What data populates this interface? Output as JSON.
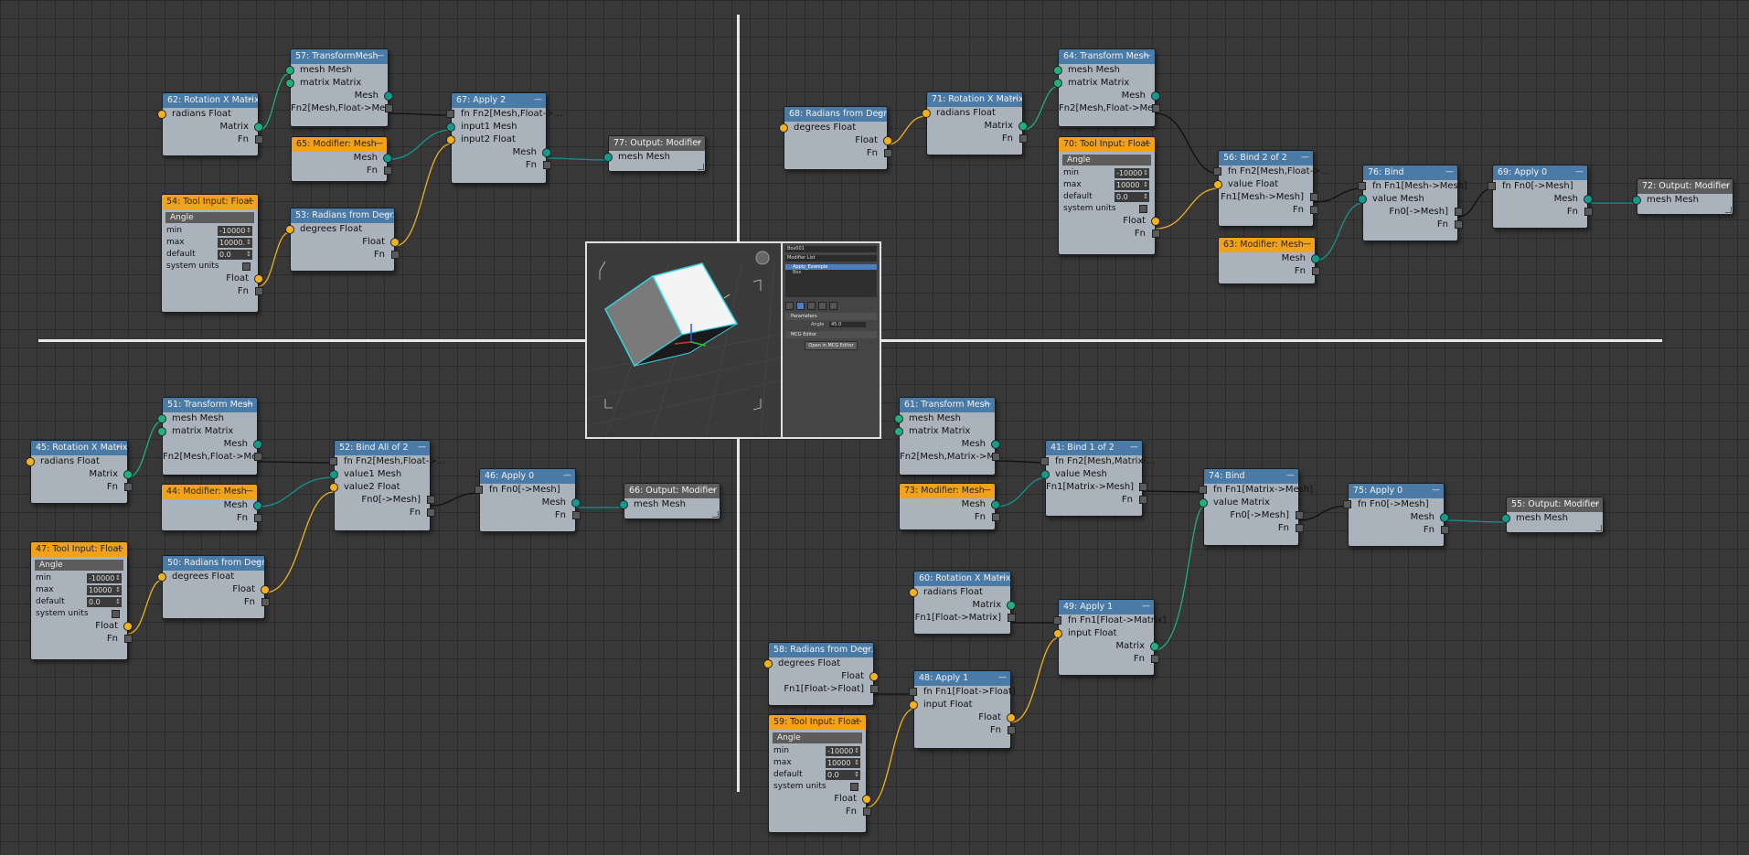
{
  "nodes": {
    "n57": {
      "title": "57: TransformMesh",
      "in": [
        "mesh Mesh",
        "matrix Matrix"
      ],
      "out": [
        "Mesh",
        "Fn2[Mesh,Float->Me..."
      ]
    },
    "n62": {
      "title": "62: Rotation X Matrix",
      "in": [
        "radians Float"
      ],
      "out": [
        "Matrix",
        "Fn"
      ]
    },
    "n65": {
      "title": "65: Modifier: Mesh",
      "out": [
        "Mesh",
        "Fn"
      ]
    },
    "n67": {
      "title": "67: Apply 2",
      "in": [
        "fn Fn2[Mesh,Float->...",
        "input1 Mesh",
        "input2 Float"
      ],
      "out": [
        "Mesh",
        "Fn"
      ]
    },
    "n77": {
      "title": "77: Output: Modifier",
      "in": [
        "mesh Mesh"
      ]
    },
    "n54": {
      "title": "54: Tool Input: Float",
      "label": "Angle",
      "min_label": "min",
      "min": "-10000",
      "max_label": "max",
      "max": "10000.",
      "default_label": "default",
      "default": "0.0",
      "sys_label": "system units",
      "out": [
        "Float",
        "Fn"
      ]
    },
    "n53": {
      "title": "53: Radians from Degr...",
      "in": [
        "degrees Float"
      ],
      "out": [
        "Float",
        "Fn"
      ]
    },
    "n64": {
      "title": "64: Transform Mesh",
      "in": [
        "mesh Mesh",
        "matrix Matrix"
      ],
      "out": [
        "Mesh",
        "Fn2[Mesh,Float->Me..."
      ]
    },
    "n68": {
      "title": "68: Radians from Degr...",
      "in": [
        "degrees Float"
      ],
      "out": [
        "Float",
        "Fn"
      ]
    },
    "n71": {
      "title": "71: Rotation X Matrix",
      "in": [
        "radians Float"
      ],
      "out": [
        "Matrix",
        "Fn"
      ]
    },
    "n70": {
      "title": "70: Tool Input: Float",
      "label": "Angle",
      "min_label": "min",
      "min": "-10000",
      "max_label": "max",
      "max": "10000",
      "default_label": "default",
      "default": "0.0",
      "sys_label": "system units",
      "out": [
        "Float",
        "Fn"
      ]
    },
    "n56": {
      "title": "56: Bind 2 of 2",
      "in": [
        "fn Fn2[Mesh,Float->...",
        "value Float"
      ],
      "out": [
        "Fn1[Mesh->Mesh]",
        "Fn"
      ]
    },
    "n76": {
      "title": "76: Bind",
      "in": [
        "fn Fn1[Mesh->Mesh]",
        "value Mesh"
      ],
      "out": [
        "Fn0[->Mesh]",
        "Fn"
      ]
    },
    "n69": {
      "title": "69: Apply 0",
      "in": [
        "fn Fn0[->Mesh]"
      ],
      "out": [
        "Mesh",
        "Fn"
      ]
    },
    "n72": {
      "title": "72: Output: Modifier",
      "in": [
        "mesh Mesh"
      ]
    },
    "n63": {
      "title": "63: Modifier: Mesh",
      "out": [
        "Mesh",
        "Fn"
      ]
    },
    "n51": {
      "title": "51: Transform Mesh",
      "in": [
        "mesh Mesh",
        "matrix Matrix"
      ],
      "out": [
        "Mesh",
        "Fn2[Mesh,Float->Me..."
      ]
    },
    "n45": {
      "title": "45: Rotation X Matrix",
      "in": [
        "radians Float"
      ],
      "out": [
        "Matrix",
        "Fn"
      ]
    },
    "n44": {
      "title": "44: Modifier: Mesh",
      "out": [
        "Mesh",
        "Fn"
      ]
    },
    "n52": {
      "title": "52: Bind All of 2",
      "in": [
        "fn Fn2[Mesh,Float->...",
        "value1 Mesh",
        "value2 Float"
      ],
      "out": [
        "Fn0[->Mesh]",
        "Fn"
      ]
    },
    "n46": {
      "title": "46: Apply 0",
      "in": [
        "fn Fn0[->Mesh]"
      ],
      "out": [
        "Mesh",
        "Fn"
      ]
    },
    "n66": {
      "title": "66: Output: Modifier",
      "in": [
        "mesh Mesh"
      ]
    },
    "n47": {
      "title": "47: Tool Input: Float",
      "label": "Angle",
      "min_label": "min",
      "min": "-10000",
      "max_label": "max",
      "max": "10000",
      "default_label": "default",
      "default": "0.0",
      "sys_label": "system units",
      "out": [
        "Float",
        "Fn"
      ]
    },
    "n50": {
      "title": "50: Radians from Degr...",
      "in": [
        "degrees Float"
      ],
      "out": [
        "Float",
        "Fn"
      ]
    },
    "n61": {
      "title": "61: Transform Mesh",
      "in": [
        "mesh Mesh",
        "matrix Matrix"
      ],
      "out": [
        "Mesh",
        "Fn2[Mesh,Matrix->M..."
      ]
    },
    "n41": {
      "title": "41: Bind 1 of 2",
      "in": [
        "fn Fn2[Mesh,Matrix-...",
        "value Mesh"
      ],
      "out": [
        "Fn1[Matrix->Mesh]",
        "Fn"
      ]
    },
    "n73": {
      "title": "73: Modifier: Mesh",
      "out": [
        "Mesh",
        "Fn"
      ]
    },
    "n74": {
      "title": "74: Bind",
      "in": [
        "fn Fn1[Matrix->Mesh]",
        "value Matrix"
      ],
      "out": [
        "Fn0[->Mesh]",
        "Fn"
      ]
    },
    "n75": {
      "title": "75: Apply 0",
      "in": [
        "fn Fn0[->Mesh]"
      ],
      "out": [
        "Mesh",
        "Fn"
      ]
    },
    "n55": {
      "title": "55: Output: Modifier",
      "in": [
        "mesh Mesh"
      ]
    },
    "n60": {
      "title": "60: Rotation X Matrix",
      "in": [
        "radians Float"
      ],
      "out": [
        "Matrix",
        "Fn1[Float->Matrix]"
      ]
    },
    "n49": {
      "title": "49: Apply 1",
      "in": [
        "fn Fn1[Float->Matrix]",
        "input Float"
      ],
      "out": [
        "Matrix",
        "Fn"
      ]
    },
    "n58": {
      "title": "58: Radians from Degr...",
      "in": [
        "degrees Float"
      ],
      "out": [
        "Float",
        "Fn1[Float->Float]"
      ]
    },
    "n48": {
      "title": "48: Apply 1",
      "in": [
        "fn Fn1[Float->Float]",
        "input Float"
      ],
      "out": [
        "Float",
        "Fn"
      ]
    },
    "n59": {
      "title": "59: Tool Input: Float",
      "label": "Angle",
      "min_label": "min",
      "min": "-10000",
      "max_label": "max",
      "max": "10000",
      "default_label": "default",
      "default": "0.0",
      "sys_label": "system units",
      "out": [
        "Float",
        "Fn"
      ]
    }
  },
  "viewport": {
    "name_field": "Box001",
    "modifier_list": "Modifier List",
    "stack": [
      "Apply_Example",
      "Box"
    ],
    "rollout_params": "Parameters",
    "param_label": "Angle",
    "param_value": "45.0",
    "rollout_mcg": "MCG Editor",
    "open_button": "Open in MCG Editor"
  },
  "colors": {
    "wire_green": "#1fb07a",
    "wire_teal": "#15928a",
    "wire_yellow": "#f0b01c",
    "wire_black": "#0f0f0f",
    "header_blue": "#4a7aa6",
    "header_orange": "#f0a21d",
    "header_gray": "#5c5c5c"
  }
}
